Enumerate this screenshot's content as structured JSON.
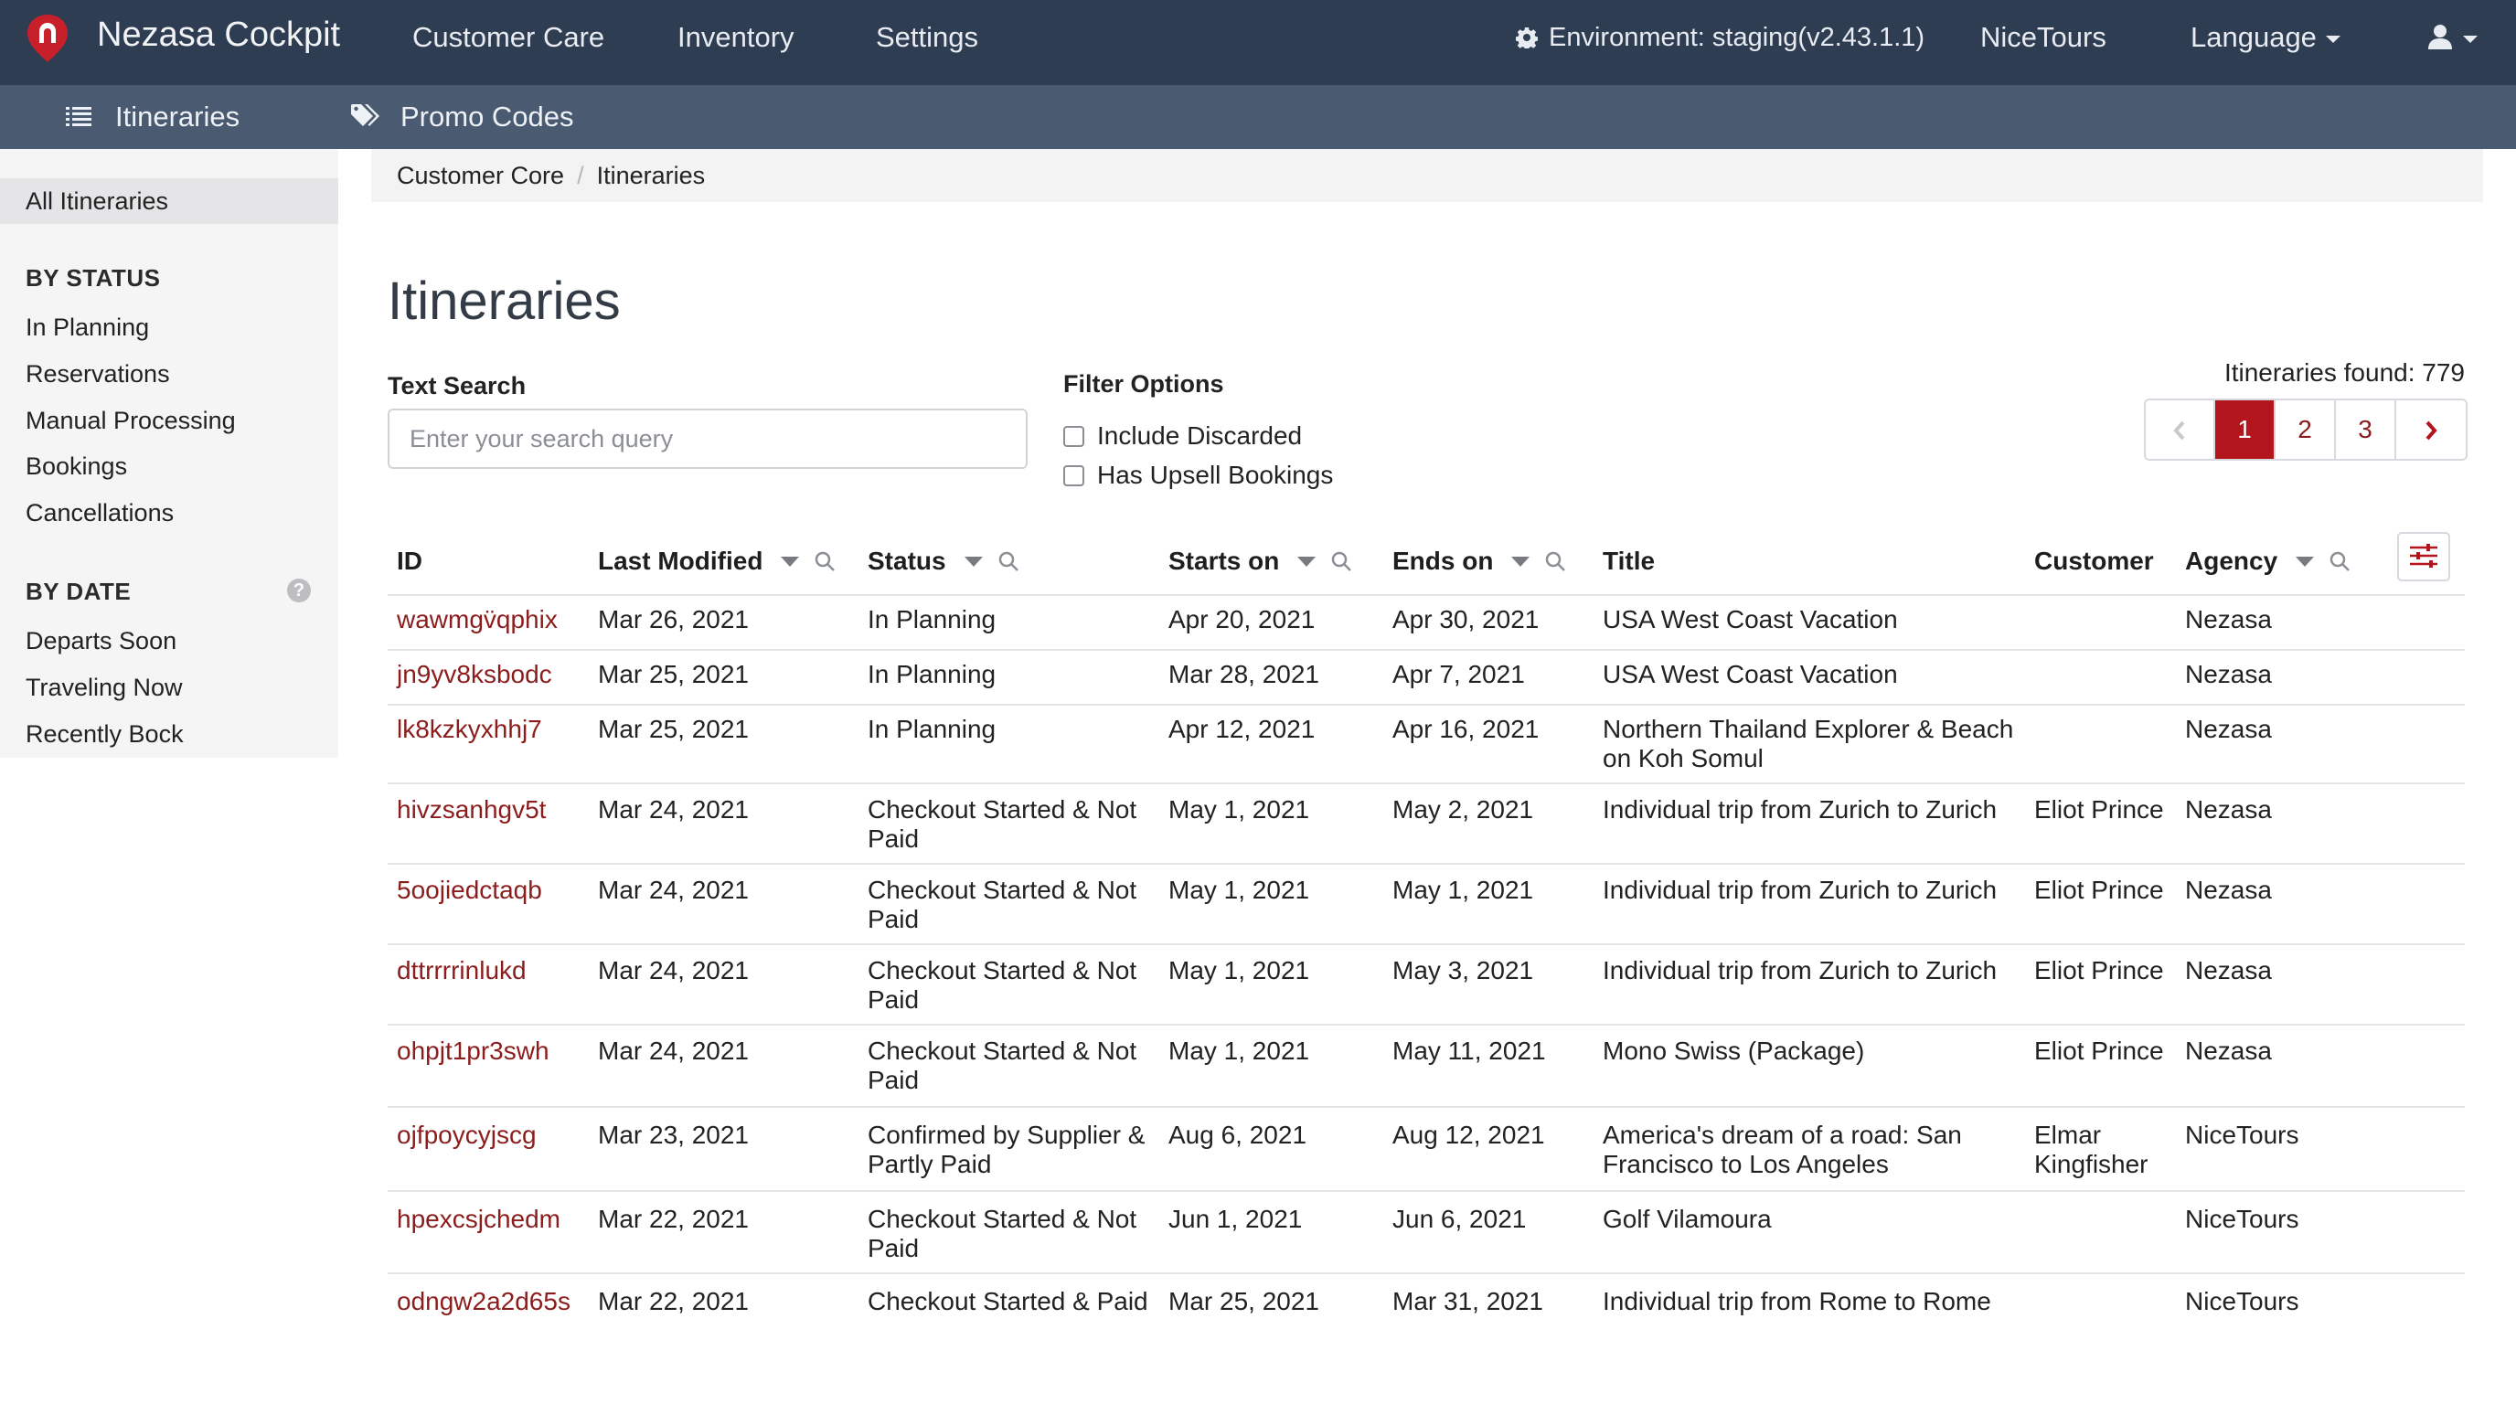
{
  "topbar": {
    "brand": "Nezasa Cockpit",
    "nav": [
      "Customer Care",
      "Inventory",
      "Settings"
    ],
    "environment": "Environment: staging(v2.43.1.1)",
    "tenant": "NiceTours",
    "language": "Language"
  },
  "subbar": {
    "itineraries": "Itineraries",
    "promo_codes": "Promo Codes"
  },
  "sidebar": {
    "all": "All Itineraries",
    "by_status_heading": "BY STATUS",
    "status_items": [
      "In Planning",
      "Reservations",
      "Manual Processing",
      "Bookings",
      "Cancellations"
    ],
    "by_date_heading": "BY DATE",
    "help_glyph": "?",
    "date_items": [
      "Departs Soon",
      "Traveling Now",
      "Recently Bock"
    ]
  },
  "breadcrumb": [
    "Customer Core",
    "Itineraries"
  ],
  "page_title": "Itineraries",
  "search": {
    "label": "Text Search",
    "placeholder": "Enter your search query",
    "value": ""
  },
  "filters": {
    "label": "Filter Options",
    "options": [
      {
        "label": "Include Discarded",
        "checked": false
      },
      {
        "label": "Has Upsell Bookings",
        "checked": false
      }
    ]
  },
  "results_found": "Itineraries found: 779",
  "pagination": {
    "prev": "‹",
    "pages": [
      "1",
      "2",
      "3"
    ],
    "current": "1",
    "next": "›"
  },
  "table": {
    "headers": [
      "ID",
      "Last Modified",
      "Status",
      "Starts on",
      "Ends on",
      "Title",
      "Customer",
      "Agency"
    ],
    "rows": [
      [
        "wawmgv̈qphix",
        "Mar 26, 2021",
        "In Planning",
        "Apr 20, 2021",
        "Apr 30, 2021",
        "USA West Coast Vacation",
        "",
        "Nezasa"
      ],
      [
        "jn9yv8ksbodc",
        "Mar 25, 2021",
        "In Planning",
        "Mar 28, 2021",
        "Apr 7, 2021",
        "USA West Coast Vacation",
        "",
        "Nezasa"
      ],
      [
        "lk8kzkyxhhj7",
        "Mar 25, 2021",
        "In Planning",
        "Apr 12, 2021",
        "Apr 16, 2021",
        "Northern Thailand Explorer & Beach on Koh Somul",
        "",
        "Nezasa"
      ],
      [
        "hivzsanhgv5t",
        "Mar 24, 2021",
        "Checkout Started & Not Paid",
        "May 1, 2021",
        "May 2, 2021",
        "Individual trip from Zurich to Zurich",
        "Eliot Prince",
        "Nezasa"
      ],
      [
        "5oojiedctaqb",
        "Mar 24, 2021",
        "Checkout Started & Not Paid",
        "May 1, 2021",
        "May 1, 2021",
        "Individual trip from Zurich to Zurich",
        "Eliot Prince",
        "Nezasa"
      ],
      [
        "dttrrrrinlukd",
        "Mar 24, 2021",
        "Checkout Started & Not Paid",
        "May 1, 2021",
        "May 3, 2021",
        "Individual trip from Zurich to Zurich",
        "Eliot Prince",
        "Nezasa"
      ],
      [
        "ohpjt1pr3swh",
        "Mar 24, 2021",
        "Checkout Started & Not Paid",
        "May 1, 2021",
        "May 11, 2021",
        "Mono Swiss (Package)",
        "Eliot Prince",
        "Nezasa"
      ],
      [
        "ojfpoycyjscg",
        "Mar 23, 2021",
        "Confirmed by Supplier & Partly Paid",
        "Aug 6, 2021",
        "Aug 12, 2021",
        "America's dream of a road: San Francisco to Los Angeles",
        "Elmar Kingfisher",
        "NiceTours"
      ],
      [
        "hpexcsjchedm",
        "Mar 22, 2021",
        "Checkout Started & Not Paid",
        "Jun 1, 2021",
        "Jun 6, 2021",
        "Golf Vilamoura",
        "",
        "NiceTours"
      ],
      [
        "odngw2a2d65s",
        "Mar 22, 2021",
        "Checkout Started & Paid",
        "Mar 25, 2021",
        "Mar 31, 2021",
        "Individual trip from Rome to Rome",
        "",
        "NiceTours"
      ]
    ]
  },
  "colors": {
    "navbar": "#2f3d52",
    "subbar": "#4a5a70",
    "accent": "#b3151c",
    "link": "#8c1d1d"
  },
  "icons": {
    "logo": "nezasa-logo-icon",
    "environment": "gear-icon",
    "subnav_itineraries": "list-icon",
    "subnav_promo": "tags-icon",
    "user": "user-icon",
    "column_settings": "sliders-icon",
    "filter": "search-icon",
    "sort": "caret-down-icon"
  }
}
